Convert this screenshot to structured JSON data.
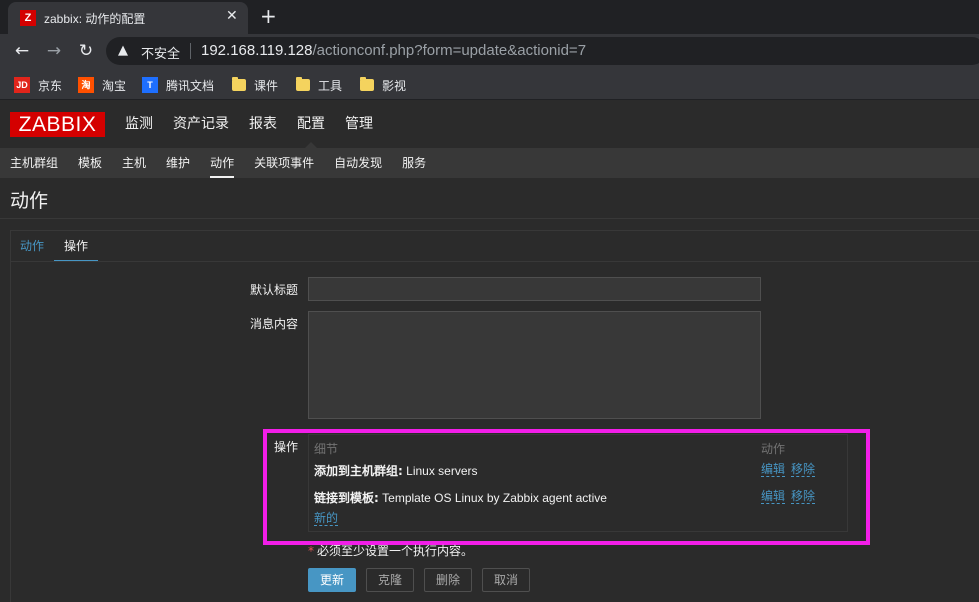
{
  "browser": {
    "tab_title": "zabbix: 动作的配置",
    "tab_favicon": "Z",
    "insecure_label": "不安全",
    "url_host": "192.168.119.128",
    "url_path": "/actionconf.php?form=update&actionid=7",
    "bookmarks": [
      {
        "label": "京东",
        "icon": "JD",
        "color": "#e1251b"
      },
      {
        "label": "淘宝",
        "icon": "淘",
        "color": "#ff5000"
      },
      {
        "label": "腾讯文档",
        "icon": "T",
        "color": "#1e6fff"
      },
      {
        "label": "课件",
        "icon": "folder-icon"
      },
      {
        "label": "工具",
        "icon": "folder-icon"
      },
      {
        "label": "影视",
        "icon": "folder-icon"
      }
    ]
  },
  "header": {
    "logo": "ZABBIX",
    "menu": [
      "监测",
      "资产记录",
      "报表",
      "配置",
      "管理"
    ],
    "active_menu": "配置"
  },
  "submenu": {
    "items": [
      "主机群组",
      "模板",
      "主机",
      "维护",
      "动作",
      "关联项事件",
      "自动发现",
      "服务"
    ],
    "active": "动作"
  },
  "page": {
    "title": "动作",
    "tabs": [
      "动作",
      "操作"
    ],
    "active_tab": "操作"
  },
  "form": {
    "default_subject_label": "默认标题",
    "default_subject_value": "",
    "message_label": "消息内容",
    "message_value": "",
    "operations_label": "操作",
    "ops_col_details": "细节",
    "ops_col_action": "动作",
    "operations": [
      {
        "type": "添加到主机群组:",
        "value": " Linux servers",
        "edit": "编辑",
        "remove": "移除"
      },
      {
        "type": "链接到模板:",
        "value": " Template OS Linux by Zabbix agent active",
        "edit": "编辑",
        "remove": "移除"
      }
    ],
    "new_link": "新的",
    "required_note": "必须至少设置一个执行内容。",
    "buttons": {
      "update": "更新",
      "clone": "克隆",
      "delete": "删除",
      "cancel": "取消"
    }
  },
  "colors": {
    "accent": "#4796c4",
    "logo_red": "#d40000",
    "highlight": "#f21ee8"
  }
}
